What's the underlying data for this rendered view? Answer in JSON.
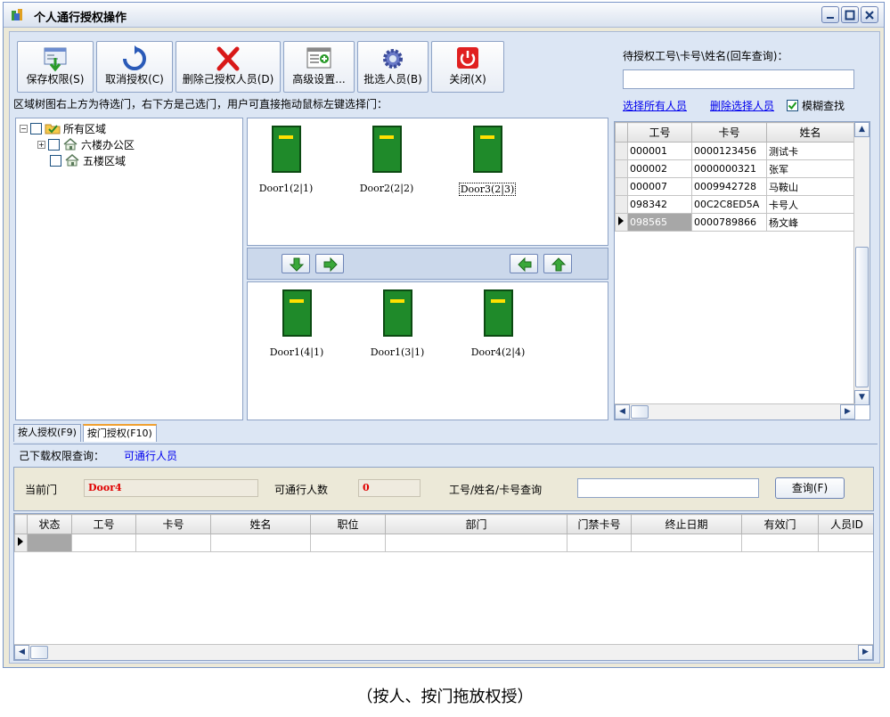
{
  "window": {
    "title": "个人通行授权操作",
    "icon": "app-icon",
    "controls": [
      "minimize-icon",
      "maximize-icon",
      "close-icon"
    ]
  },
  "toolbar": {
    "buttons": [
      {
        "label": "保存权限(S)",
        "icon": "save-icon"
      },
      {
        "label": "取消授权(C)",
        "icon": "refresh-icon"
      },
      {
        "label": "删除己授权人员(D)",
        "icon": "delete-x-icon"
      },
      {
        "label": "高级设置...",
        "icon": "settings-window-icon"
      },
      {
        "label": "批选人员(B)",
        "icon": "gear-icon"
      },
      {
        "label": "关闭(X)",
        "icon": "power-icon"
      }
    ]
  },
  "hint": "区域树图右上方为待选门，右下方是己选门，用户可直接拖动鼠标左键选择门：",
  "tree": {
    "root": {
      "label": "所有区域"
    },
    "children": [
      {
        "label": "六楼办公区"
      },
      {
        "label": "五楼区域"
      }
    ]
  },
  "doors_pending": [
    "Door1(2|1)",
    "Door2(2|2)",
    "Door3(2|3)"
  ],
  "doors_selected": [
    "Door1(4|1)",
    "Door1(3|1)",
    "Door4(2|4)"
  ],
  "search": {
    "label": "待授权工号\\卡号\\姓名(回车查询)：",
    "value": "",
    "select_all": "选择所有人员",
    "delete_selected": "删除选择人员",
    "fuzzy_label": "模糊查找",
    "fuzzy_checked": true
  },
  "people_grid": {
    "columns": [
      "工号",
      "卡号",
      "姓名"
    ],
    "rows": [
      [
        "000001",
        "0000123456",
        "测试卡"
      ],
      [
        "000002",
        "0000000321",
        "张军"
      ],
      [
        "000007",
        "0009942728",
        "马鞍山"
      ],
      [
        "098342",
        "00C2C8ED5A",
        "卡号人"
      ],
      [
        "098565",
        "0000789866",
        "杨文峰"
      ]
    ],
    "selected_row": 4
  },
  "tabs": [
    "按人授权(F9)",
    "按门授权(F10)"
  ],
  "active_tab": 1,
  "query_line": {
    "label": "己下载权限查询：",
    "link": "可通行人员"
  },
  "door_query": {
    "current_door_label": "当前门",
    "current_door_value": "Door4",
    "count_label": "可通行人数",
    "count_value": "0",
    "search_label": "工号/姓名/卡号查询",
    "search_value": "",
    "button": "查询(F)"
  },
  "result_grid": {
    "columns": [
      "状态",
      "工号",
      "卡号",
      "姓名",
      "职位",
      "部门",
      "门禁卡号",
      "终止日期",
      "有效门",
      "人员ID"
    ]
  },
  "caption": "（按人、按门拖放权授）"
}
